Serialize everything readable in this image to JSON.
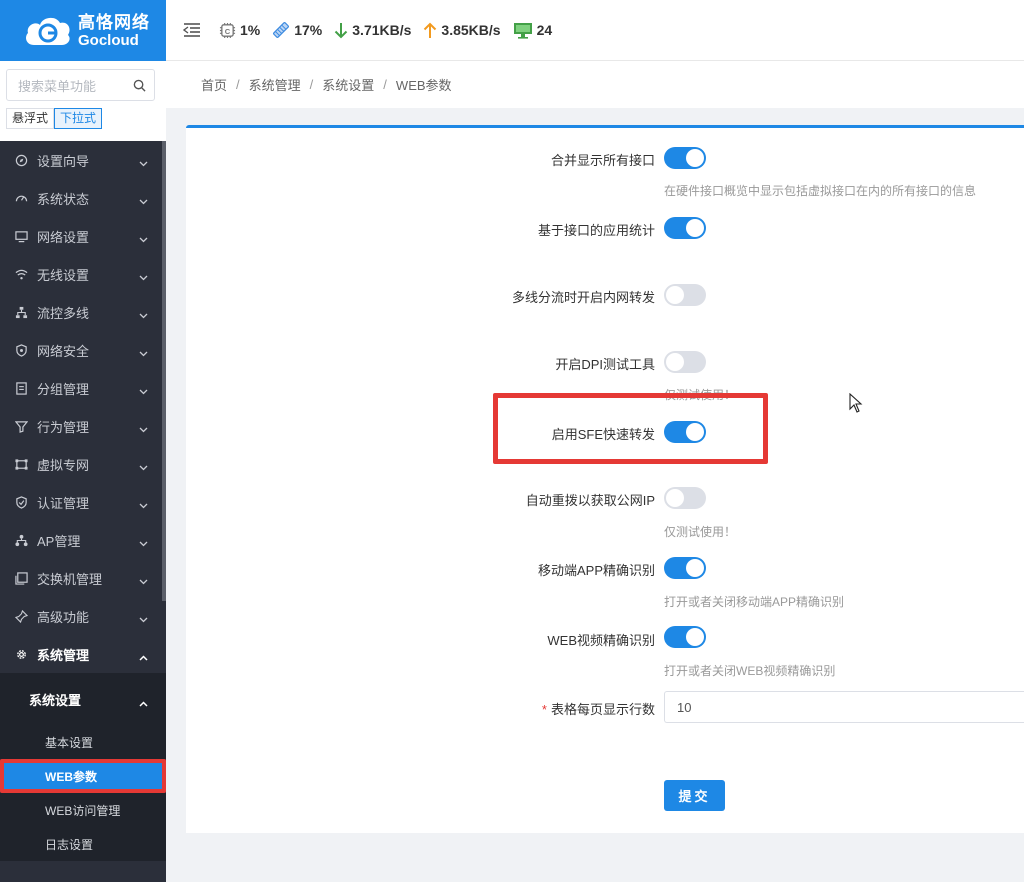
{
  "brand": {
    "name_cn": "高恪网络",
    "name_en": "Gocloud"
  },
  "search": {
    "placeholder": "搜索菜单功能"
  },
  "menu_modes": [
    "悬浮式",
    "下拉式"
  ],
  "topbar": {
    "cpu": "1%",
    "memory": "17%",
    "download": "3.71KB/s",
    "upload": "3.85KB/s",
    "clients": "24"
  },
  "menu": [
    {
      "label": "设置向导",
      "icon": "compass-icon"
    },
    {
      "label": "系统状态",
      "icon": "dashboard-icon"
    },
    {
      "label": "网络设置",
      "icon": "monitor-icon"
    },
    {
      "label": "无线设置",
      "icon": "wifi-icon"
    },
    {
      "label": "流控多线",
      "icon": "network-icon"
    },
    {
      "label": "网络安全",
      "icon": "shield-icon"
    },
    {
      "label": "分组管理",
      "icon": "list-icon"
    },
    {
      "label": "行为管理",
      "icon": "filter-icon"
    },
    {
      "label": "虚拟专网",
      "icon": "vpn-icon"
    },
    {
      "label": "认证管理",
      "icon": "shield-check-icon"
    },
    {
      "label": "AP管理",
      "icon": "tree-icon"
    },
    {
      "label": "交换机管理",
      "icon": "switch-icon"
    },
    {
      "label": "高级功能",
      "icon": "pin-icon"
    },
    {
      "label": "系统管理",
      "icon": "gear-icon"
    }
  ],
  "submenu": {
    "header": "系统设置",
    "items": [
      "基本设置",
      "WEB参数",
      "WEB访问管理",
      "日志设置"
    ]
  },
  "breadcrumb": [
    "首页",
    "系统管理",
    "系统设置",
    "WEB参数"
  ],
  "settings": [
    {
      "label": "合并显示所有接口",
      "on": true,
      "hint": "在硬件接口概览中显示包括虚拟接口在内的所有接口的信息"
    },
    {
      "label": "基于接口的应用统计",
      "on": true,
      "hint": ""
    },
    {
      "label": "多线分流时开启内网转发",
      "on": false,
      "hint": ""
    },
    {
      "label": "开启DPI测试工具",
      "on": false,
      "hint": "仅测试使用！"
    },
    {
      "label": "启用SFE快速转发",
      "on": true,
      "hint": ""
    },
    {
      "label": "自动重拨以获取公网IP",
      "on": false,
      "hint": "仅测试使用！"
    },
    {
      "label": "移动端APP精确识别",
      "on": true,
      "hint": "打开或者关闭移动端APP精确识别"
    },
    {
      "label": "WEB视频精确识别",
      "on": true,
      "hint": "打开或者关闭WEB视频精确识别"
    }
  ],
  "rows_per_page": {
    "label": "表格每页显示行数",
    "required_mark": "*",
    "value": "10"
  },
  "submit_label": "提交",
  "colors": {
    "accent": "#1e88e5",
    "sidebar": "#2b2f3a",
    "highlight": "#e53935"
  }
}
